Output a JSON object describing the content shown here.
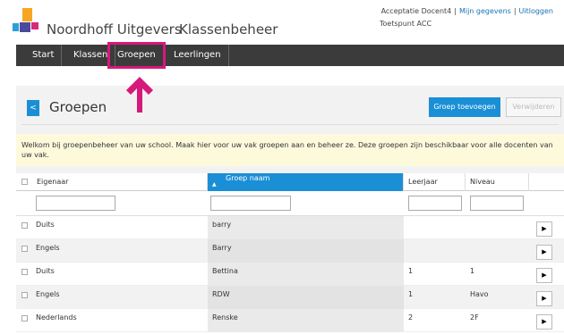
{
  "header": {
    "brand": "Noordhoff Uitgevers",
    "app_name": "Klassenbeheer",
    "user_name": "Acceptatie Docent4",
    "my_data_link": "Mijn gegevens",
    "logout_link": "Uitloggen",
    "separator": "|",
    "location": "Toetspunt ACC"
  },
  "nav": {
    "items": [
      {
        "label": "Start"
      },
      {
        "label": "Klassen"
      },
      {
        "label": "Groepen"
      },
      {
        "label": "Leerlingen"
      }
    ]
  },
  "page": {
    "back_icon": "<",
    "title": "Groepen",
    "add_button": "Groep toevoegen",
    "delete_button": "Verwijderen",
    "notice": "Welkom bij groepenbeheer van uw school. Maak hier voor uw vak groepen aan en beheer ze. Deze groepen zijn beschikbaar voor alle docenten van uw vak."
  },
  "table": {
    "columns": [
      "Eigenaar",
      "Groep naam",
      "Leerjaar",
      "Niveau"
    ],
    "sort_indicator": "▲",
    "rows": [
      {
        "owner": "Duits",
        "group": "barry",
        "year": "",
        "level": ""
      },
      {
        "owner": "Engels",
        "group": "Barry",
        "year": "",
        "level": ""
      },
      {
        "owner": "Duits",
        "group": "Bettina",
        "year": "1",
        "level": "1"
      },
      {
        "owner": "Engels",
        "group": "RDW",
        "year": "1",
        "level": "Havo"
      },
      {
        "owner": "Nederlands",
        "group": "Renske",
        "year": "2",
        "level": "2F"
      }
    ],
    "row_action_icon": "▶"
  },
  "colors": {
    "accent_blue": "#1a8fd6",
    "nav_bg": "#3b3b3b",
    "highlight_pink": "#d6197a",
    "notice_bg": "#fdfadc"
  }
}
